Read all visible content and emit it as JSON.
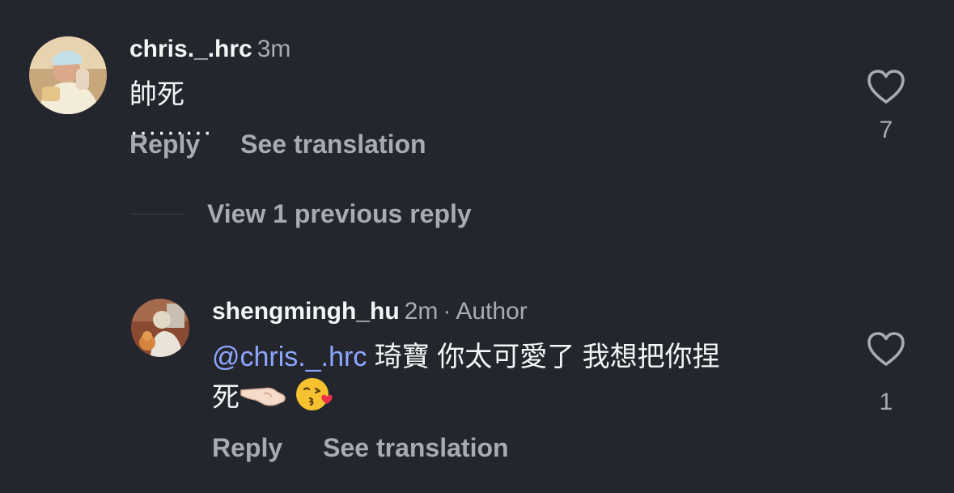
{
  "comments": [
    {
      "username": "chris._.hrc",
      "time": "3m",
      "text": "帥死 ·········",
      "reply_label": "Reply",
      "translate_label": "See translation",
      "like_count": "7"
    },
    {
      "username": "shengmingh_hu",
      "time": "2m",
      "separator": "·",
      "author_label": "Author",
      "mention": "@chris._.hrc",
      "text_line1": " 琦寶 你太可愛了 我想把你捏",
      "text_line2": "死",
      "emoji_1": "hand-pinch-emoji",
      "emoji_2": "kissing-heart-emoji",
      "reply_label": "Reply",
      "translate_label": "See translation",
      "like_count": "1"
    }
  ],
  "view_replies_label": "View 1 previous reply",
  "colors": {
    "background": "#23262d",
    "primary_text": "#f3f5f7",
    "secondary_text": "#a8abb2",
    "mention": "#8fa6ff"
  }
}
